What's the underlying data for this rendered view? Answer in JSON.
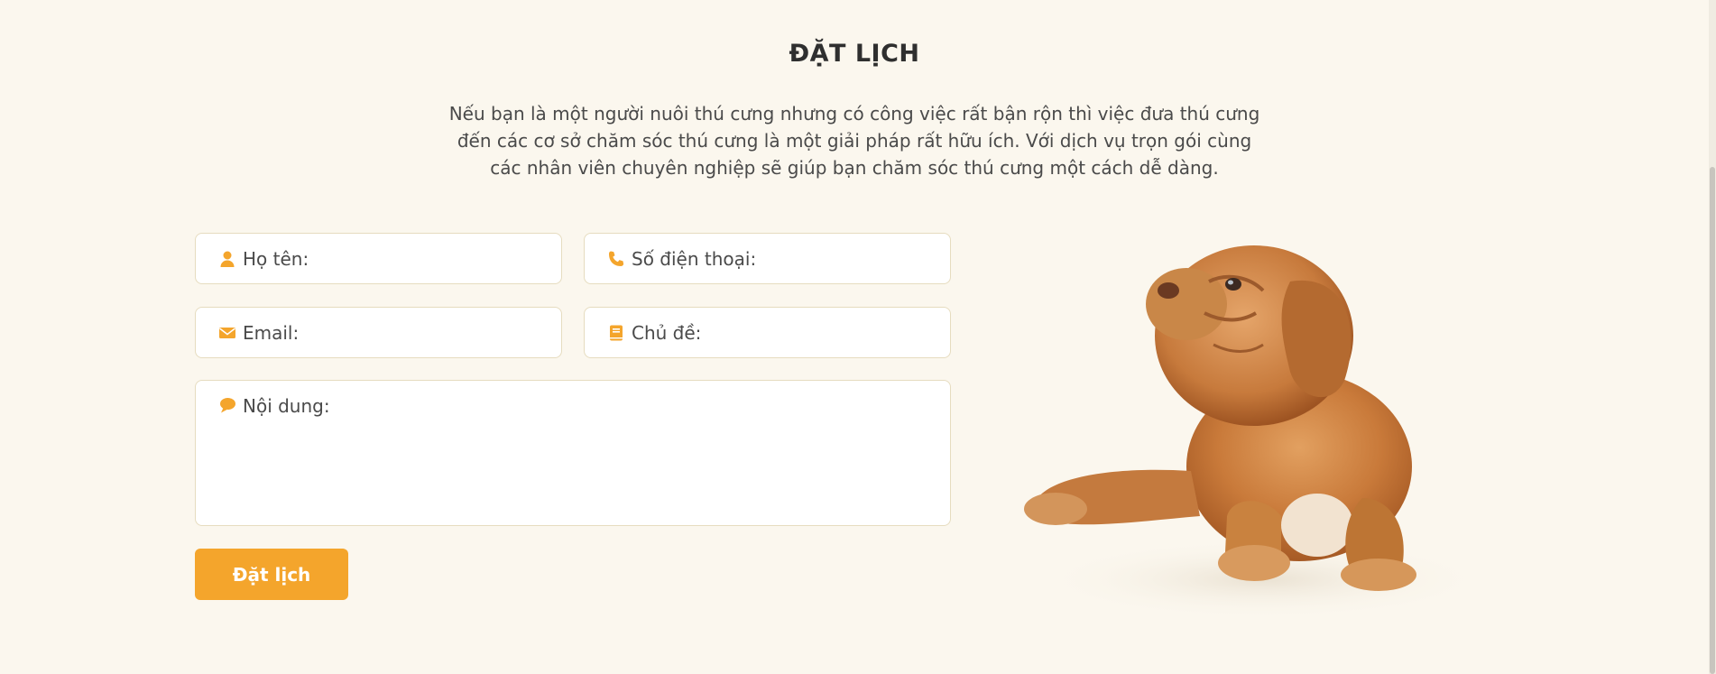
{
  "section": {
    "title": "ĐẶT LỊCH",
    "description_lines": [
      "Nếu bạn là một người nuôi thú cưng nhưng có công việc rất bận rộn thì việc đưa thú cưng",
      "đến các cơ sở chăm sóc thú cưng là một giải pháp rất hữu ích. Với dịch vụ trọn gói cùng",
      "các nhân viên chuyên nghiệp sẽ giúp bạn chăm sóc thú cưng một cách dễ dàng."
    ]
  },
  "form": {
    "name": {
      "placeholder": "Họ tên:",
      "value": "",
      "icon": "user-icon"
    },
    "phone": {
      "placeholder": "Số điện thoại:",
      "value": "",
      "icon": "phone-icon"
    },
    "email": {
      "placeholder": "Email:",
      "value": "",
      "icon": "envelope-icon"
    },
    "topic": {
      "placeholder": "Chủ đề:",
      "value": "",
      "icon": "book-icon"
    },
    "content": {
      "placeholder": "Nội dung:",
      "value": "",
      "icon": "comment-icon"
    },
    "submit_label": "Đặt lịch"
  },
  "image": {
    "subject": "puppy-illustration"
  },
  "colors": {
    "background": "#fbf7ee",
    "accent": "#f4a52c",
    "field_border": "#e6dcbf",
    "text": "#4a4a4a"
  }
}
